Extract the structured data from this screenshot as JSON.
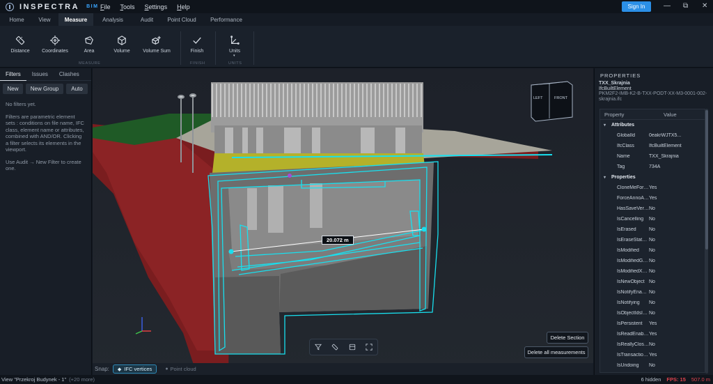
{
  "app": {
    "name": "INSPECTRA",
    "sub": "BIM",
    "signin": "Sign In"
  },
  "menu": [
    {
      "label": "File",
      "u": "F",
      "rest": "ile"
    },
    {
      "label": "Tools",
      "u": "T",
      "rest": "ools"
    },
    {
      "label": "Settings",
      "u": "S",
      "rest": "ettings"
    },
    {
      "label": "Help",
      "u": "H",
      "rest": "elp"
    }
  ],
  "window_controls": {
    "minimize": "—",
    "restore": "⧉",
    "close": "✕"
  },
  "tabs": [
    "Home",
    "View",
    "Measure",
    "Analysis",
    "Audit",
    "Point Cloud",
    "Performance"
  ],
  "active_tab": "Measure",
  "ribbon": {
    "buttons": [
      {
        "label": "Distance",
        "icon": "ruler-icon"
      },
      {
        "label": "Coordinates",
        "icon": "crosshair-icon"
      },
      {
        "label": "Area",
        "icon": "area-polygon-icon"
      },
      {
        "label": "Volume",
        "icon": "cube-icon"
      },
      {
        "label": "Volume Sum",
        "icon": "cube-sum-icon"
      },
      {
        "label": "Finish",
        "icon": "check-icon"
      },
      {
        "label": "Units",
        "icon": "units-axes-icon"
      }
    ],
    "groups": [
      "MEASURE",
      "FINISH",
      "UNITS"
    ]
  },
  "left_panel": {
    "tabs": [
      "Filters",
      "Issues",
      "Clashes"
    ],
    "active_tab": "Filters",
    "buttons": [
      "New",
      "New Group",
      "Auto"
    ],
    "empty": "No filters yet.",
    "help": "Filters are parametric element sets : conditions on file name, IFC class, element name or attributes, combined with AND/OR. Clicking a filter selects its elements in the viewport.",
    "hint": "Use Audit → New Filter to create one."
  },
  "viewport": {
    "measurement": "20.072 m",
    "viewcube": {
      "left": "LEFT",
      "front": "FRONT"
    },
    "tool_icons": [
      "filter-icon",
      "ruler-icon",
      "section-box-icon",
      "fullscreen-icon"
    ],
    "delete_section": "Delete Section",
    "delete_all": "Delete all measurements"
  },
  "snap": {
    "label": "Snap:",
    "options": [
      "IFC vertices",
      "Point cloud"
    ],
    "active": "IFC vertices"
  },
  "properties": {
    "title": "PROPERTIES",
    "object_name": "TXX_Skrajnia",
    "object_class": "IfcBuiltElement",
    "file": "PKM2F2-IMB-K2-B-TXX-PODT-XX-M3-0001-002-skrajnia.ifc",
    "col_property": "Property",
    "col_value": "Value",
    "sections": [
      {
        "name": "Attributes",
        "rows": [
          {
            "k": "GlobalId",
            "v": "0eakrWJTX5..."
          },
          {
            "k": "IfcClass",
            "v": "IfcBuiltElement"
          },
          {
            "k": "Name",
            "v": "TXX_Skrajnia"
          },
          {
            "k": "Tag",
            "v": "734A"
          }
        ]
      },
      {
        "name": "Properties",
        "rows": [
          {
            "k": "CloneMeForDra...",
            "v": "Yes"
          },
          {
            "k": "ForceAnnoAllVi...",
            "v": "Yes"
          },
          {
            "k": "HasSaveVersion...",
            "v": "No"
          },
          {
            "k": "IsCancelling",
            "v": "No"
          },
          {
            "k": "IsErased",
            "v": "No"
          },
          {
            "k": "IsEraseStatusTo...",
            "v": "No"
          },
          {
            "k": "IsModified",
            "v": "No"
          },
          {
            "k": "IsModifiedGrap...",
            "v": "No"
          },
          {
            "k": "IsModifiedXData",
            "v": "No"
          },
          {
            "k": "IsNewObject",
            "v": "No"
          },
          {
            "k": "IsNotifyEnabled",
            "v": "No"
          },
          {
            "k": "IsNotifying",
            "v": "No"
          },
          {
            "k": "IsObjectIdsInFlux",
            "v": "No"
          },
          {
            "k": "IsPersistent",
            "v": "Yes"
          },
          {
            "k": "IsReadEnabled",
            "v": "Yes"
          },
          {
            "k": "IsReallyClosing",
            "v": "No"
          },
          {
            "k": "IsTransactionRe...",
            "v": "Yes"
          },
          {
            "k": "IsUndoing",
            "v": "No"
          }
        ]
      }
    ]
  },
  "status": {
    "view": "View \"Przekroj Budynek - 1\"",
    "more": "(+20 more)",
    "hidden": "6 hidden",
    "fps": "FPS: 15",
    "distance": "507.0 m"
  },
  "colors": {
    "accent": "#2b8fe6",
    "cyan": "#18e0ef",
    "fps": "#e0434e"
  }
}
